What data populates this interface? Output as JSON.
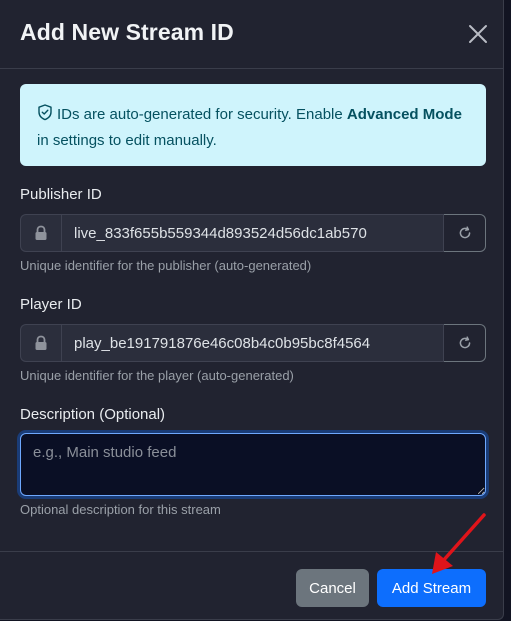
{
  "modal": {
    "title": "Add New Stream ID"
  },
  "alert": {
    "text_before": "IDs are auto-generated for security. Enable ",
    "bold": "Advanced Mode",
    "text_after": " in settings to edit manually."
  },
  "publisher": {
    "label": "Publisher ID",
    "value": "live_833f655b559344d893524d56dc1ab570",
    "help": "Unique identifier for the publisher (auto-generated)"
  },
  "player": {
    "label": "Player ID",
    "value": "play_be191791876e46c08b4c0b95bc8f4564",
    "help": "Unique identifier for the player (auto-generated)"
  },
  "description": {
    "label": "Description (Optional)",
    "placeholder": "e.g., Main studio feed",
    "value": "",
    "help": "Optional description for this stream"
  },
  "footer": {
    "cancel_label": "Cancel",
    "add_label": "Add Stream"
  },
  "colors": {
    "modal_bg": "#212330",
    "alert_bg": "#cff4fc",
    "alert_text": "#055160",
    "primary": "#0d6efd",
    "secondary": "#6c757d",
    "annotation_arrow": "#e0141a"
  },
  "icons": {
    "close": "close-icon",
    "alert": "shield-check-icon",
    "lock": "lock-icon",
    "refresh": "refresh-icon",
    "annotation": "red-arrow-icon"
  }
}
